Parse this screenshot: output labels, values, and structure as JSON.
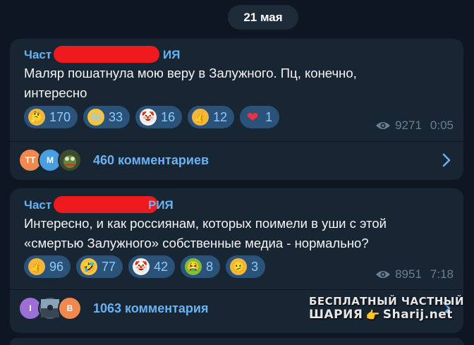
{
  "date": "21 мая",
  "messages": [
    {
      "author_start": "Част",
      "author_end": "ИЯ",
      "text_lines": [
        "Маляр пошатнула мою веру в Залужного. Пц, конечно,",
        "интересно"
      ],
      "reactions": [
        {
          "emoji": "🤔",
          "count": "170",
          "color": "#f4b63f"
        },
        {
          "emoji": "😁",
          "count": "33",
          "color": "#f4c63f"
        },
        {
          "emoji": "🤡",
          "count": "16",
          "color": "#f2f2f2"
        },
        {
          "emoji": "👍",
          "count": "12",
          "color": "#f4b63f"
        },
        {
          "emoji": "❤",
          "count": "1",
          "color": "#2b5278"
        }
      ],
      "views": "9271",
      "time": "0:05",
      "comment_avatars": [
        {
          "initials": "TT",
          "color": "#f0894f"
        },
        {
          "initials": "M",
          "color": "#4a9ee0"
        },
        {
          "initials": "",
          "color": "#4d5a3a"
        }
      ],
      "comments": "460 комментариев"
    },
    {
      "author_start": "Част",
      "author_end": "РИЯ",
      "text_lines": [
        "Интересно, и как россиянам, которых поимели в уши с этой",
        "«смертью Залужного» собственные медиа - нормально?"
      ],
      "reactions": [
        {
          "emoji": "👍",
          "count": "96",
          "color": "#f4b63f"
        },
        {
          "emoji": "🤣",
          "count": "77",
          "color": "#f4c63f"
        },
        {
          "emoji": "🤡",
          "count": "42",
          "color": "#f2f2f2"
        },
        {
          "emoji": "🤮",
          "count": "8",
          "color": "#7cbf3a"
        },
        {
          "emoji": "🫤",
          "count": "3",
          "color": "#f4b63f"
        }
      ],
      "views": "8951",
      "time": "7:18",
      "comment_avatars": [
        {
          "initials": "I",
          "color": "#9b6fd6"
        },
        {
          "initials": "",
          "color": "#5b6f80"
        },
        {
          "initials": "B",
          "color": "#f0894f"
        }
      ],
      "comments": "1063 комментария"
    }
  ],
  "watermark": {
    "line1": "БЕСПЛАТНЫЙ ЧАСТНЫЙ",
    "line2": "ШАРИЯ",
    "line2_site": "Sharij.net"
  }
}
